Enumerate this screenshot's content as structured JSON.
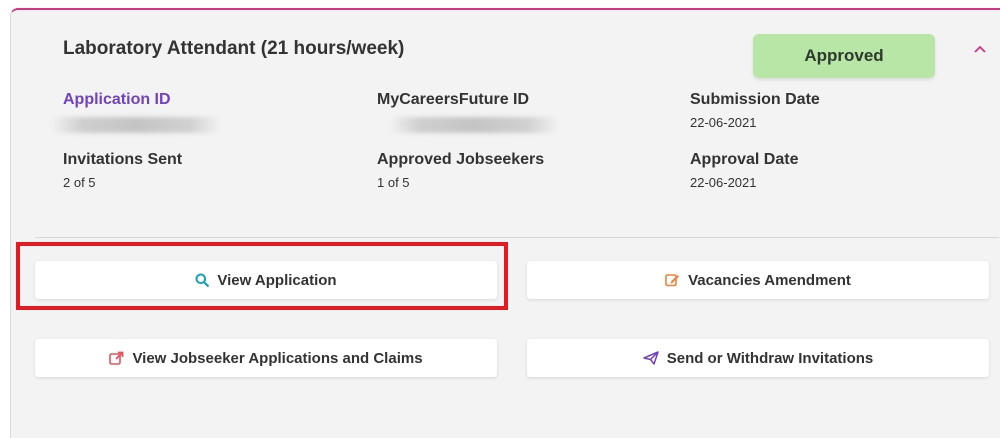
{
  "card": {
    "title": "Laboratory Attendant (21 hours/week)",
    "status": "Approved",
    "fields": {
      "application_id": {
        "label": "Application ID",
        "value": ""
      },
      "mcf_id": {
        "label": "MyCareersFuture ID",
        "value": ""
      },
      "submission_date": {
        "label": "Submission Date",
        "value": "22-06-2021"
      },
      "invitations_sent": {
        "label": "Invitations Sent",
        "value": "2 of 5"
      },
      "approved_jobseekers": {
        "label": "Approved Jobseekers",
        "value": "1 of 5"
      },
      "approval_date": {
        "label": "Approval Date",
        "value": "22-06-2021"
      }
    },
    "buttons": {
      "view_application": "View Application",
      "vacancies_amendment": "Vacancies Amendment",
      "view_jobseeker_applications": "View Jobseeker Applications and Claims",
      "send_withdraw_invitations": "Send or Withdraw Invitations"
    }
  },
  "colors": {
    "accent": "#d63384",
    "approved_badge": "#b7e6a6",
    "link_label": "#6f42c1",
    "highlight_box": "#e01b24",
    "search_icon": "#17a2b8",
    "edit_icon": "#f0803c",
    "share_icon": "#e8525a",
    "send_icon": "#6f42c1"
  },
  "icons": {
    "collapse": "chevron-up-icon",
    "view_application": "search-icon",
    "vacancies_amendment": "edit-icon",
    "view_jobseeker_applications": "external-link-icon",
    "send_withdraw_invitations": "paper-plane-icon"
  }
}
